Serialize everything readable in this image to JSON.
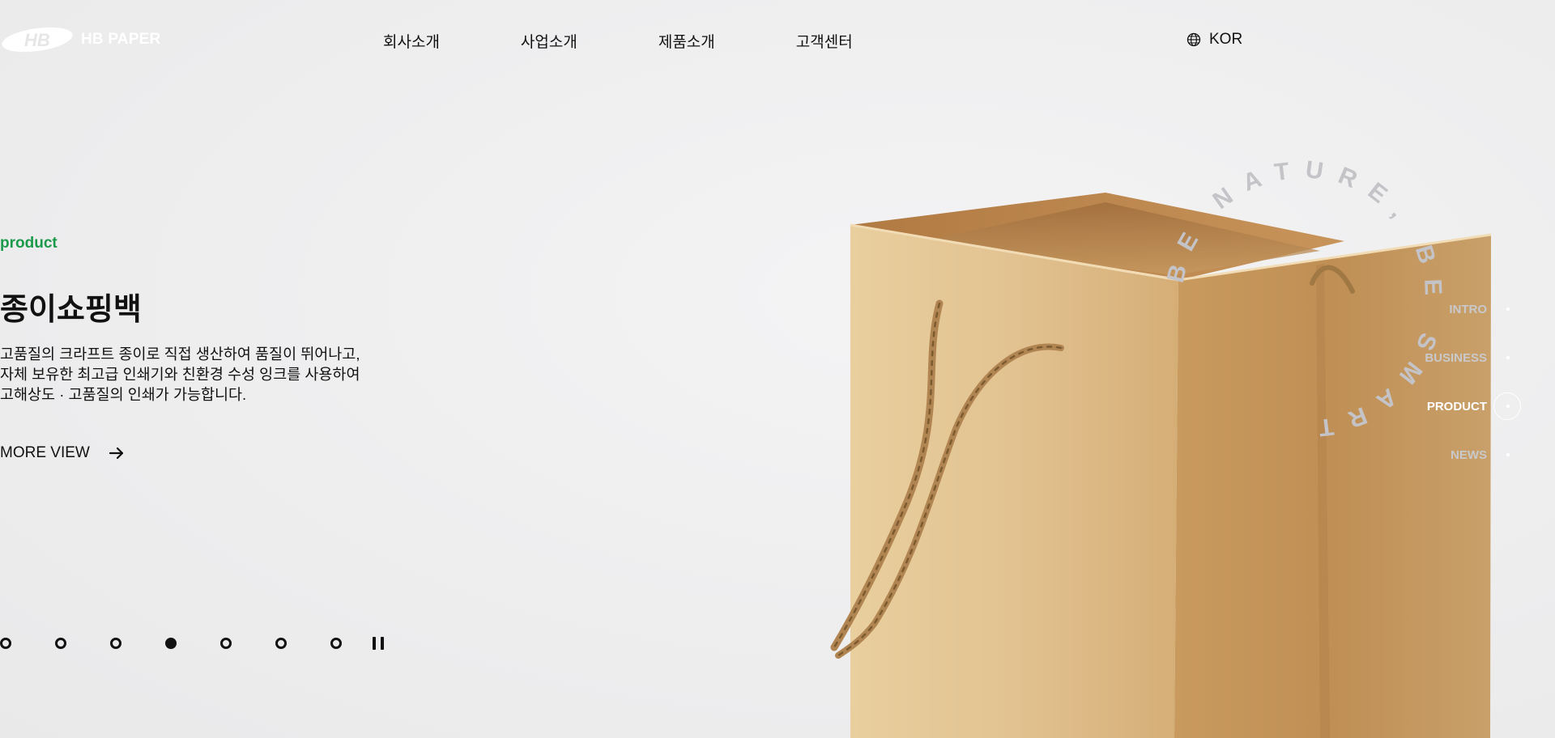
{
  "header": {
    "logo_mark": "HB",
    "logo_text": "HB PAPER",
    "nav": [
      "회사소개",
      "사업소개",
      "제품소개",
      "고객센터"
    ],
    "lang": {
      "icon": "globe-icon",
      "label": "KOR"
    }
  },
  "hero": {
    "eyebrow": "product",
    "title": "종이쇼핑백",
    "desc_lines": [
      "고품질의 크라프트 종이로 직접 생산하여 품질이 뛰어나고,",
      "자체 보유한 최고급 인쇄기와 친환경 수성 잉크를 사용하여",
      "고해상도 · 고품질의 인쇄가 가능합니다."
    ],
    "more_label": "MORE VIEW",
    "more_icon": "arrow-right-icon"
  },
  "circle_text": "BE NATURE, BE SMART",
  "pagination": {
    "count": 7,
    "active_index": 3,
    "pause_icon": "pause-icon"
  },
  "side_nav": {
    "items": [
      "INTRO",
      "BUSINESS",
      "PRODUCT",
      "NEWS"
    ],
    "active_index": 2
  },
  "colors": {
    "accent_green": "#1a9a4a",
    "text": "#111111",
    "bag_kraft": "#c89a5c"
  }
}
